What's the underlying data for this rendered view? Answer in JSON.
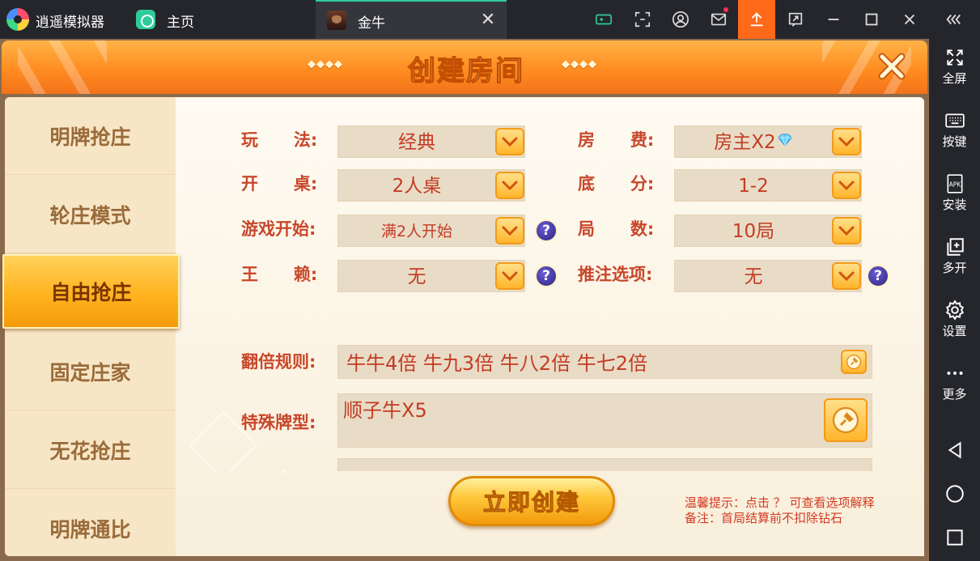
{
  "app": {
    "name": "逍遥模拟器",
    "home_label": "主页"
  },
  "tab": {
    "title": "金牛",
    "close_glyph": "✕"
  },
  "toolbar_icons": [
    "keymap-icon",
    "screenshot-icon",
    "account-icon",
    "mail-icon",
    "upload-icon",
    "crop-icon",
    "minimize-icon",
    "maximize-icon",
    "close-icon",
    "collapse-icon"
  ],
  "sidebar": {
    "fullscreen": "全屏",
    "keys": "按键",
    "install": "安装",
    "multi": "多开",
    "settings": "设置",
    "more": "更多"
  },
  "dialog": {
    "title": "创建房间",
    "deco_left": "◆◆◆◆",
    "deco_right": "◆◆◆◆"
  },
  "modes": [
    "明牌抢庄",
    "轮庄模式",
    "自由抢庄",
    "固定庄家",
    "无花抢庄",
    "明牌通比"
  ],
  "active_mode": "自由抢庄",
  "form": {
    "play_label": "玩      法:",
    "play_value": "经典",
    "fee_label": "房      费:",
    "fee_value": "房主X2",
    "table_label": "开      桌:",
    "table_value": "2人桌",
    "base_label": "底      分:",
    "base_value": "1-2",
    "start_label": "游戏开始:",
    "start_value": "满2人开始",
    "rounds_label": "局      数:",
    "rounds_value": "10局",
    "wild_label": "王      赖:",
    "wild_value": "无",
    "bet_label": "推注选项:",
    "bet_value": "无",
    "help_glyph": "?",
    "double_label": "翻倍规则:",
    "double_value": "牛牛4倍 牛九3倍 牛八2倍 牛七2倍",
    "special_label": "特殊牌型:",
    "special_value": "顺子牛X5"
  },
  "create_button": "立即创建",
  "hints": {
    "line1": "温馨提示：点击 ？ 可查看选项解释",
    "line2": "备注：首局结算前不扣除钻石"
  },
  "colors": {
    "accent_orange": "#ff6a1a",
    "label_red": "#c8472a",
    "tab_active": "#ffb31f"
  }
}
